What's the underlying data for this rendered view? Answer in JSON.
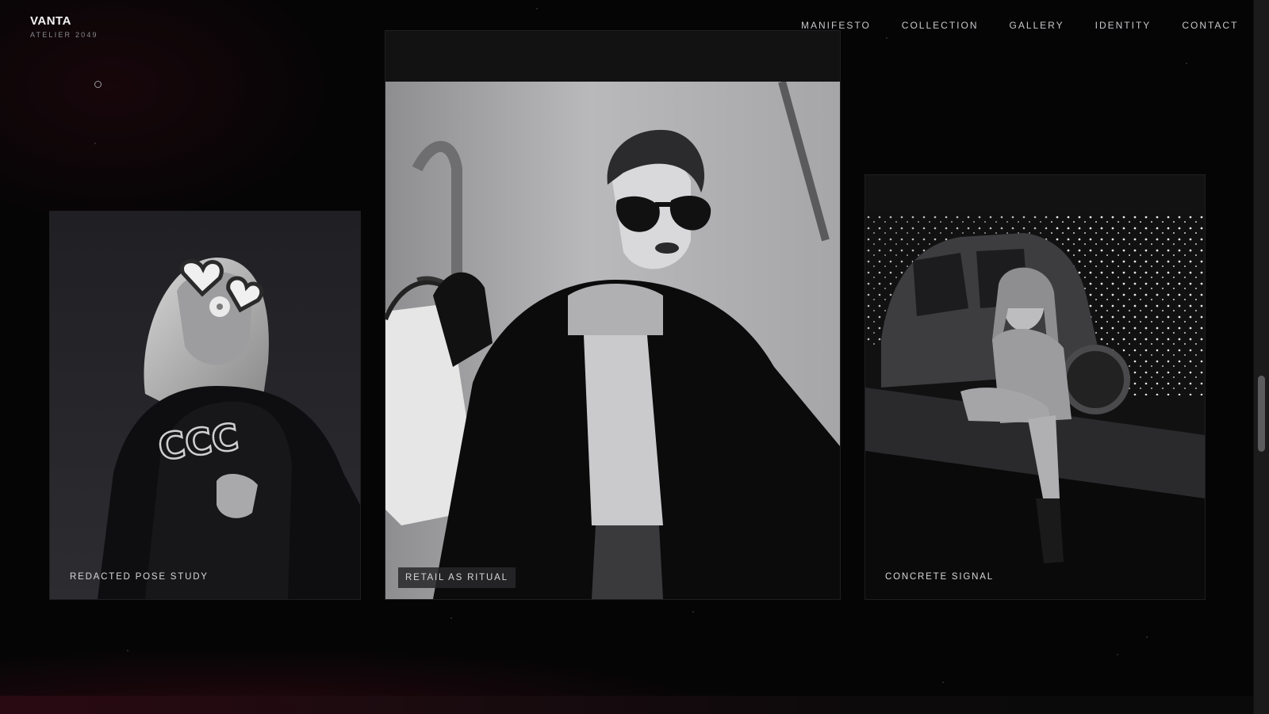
{
  "brand": {
    "name": "VANTA",
    "subtitle": "ATELIER 2049"
  },
  "nav": {
    "items": [
      {
        "label": "MANIFESTO"
      },
      {
        "label": "COLLECTION"
      },
      {
        "label": "GALLERY"
      },
      {
        "label": "IDENTITY"
      },
      {
        "label": "CONTACT"
      }
    ]
  },
  "gallery": {
    "cards": [
      {
        "caption": "REDACTED POSE STUDY"
      },
      {
        "caption": "RETAIL AS RITUAL"
      },
      {
        "caption": "CONCRETE SIGNAL"
      }
    ]
  }
}
